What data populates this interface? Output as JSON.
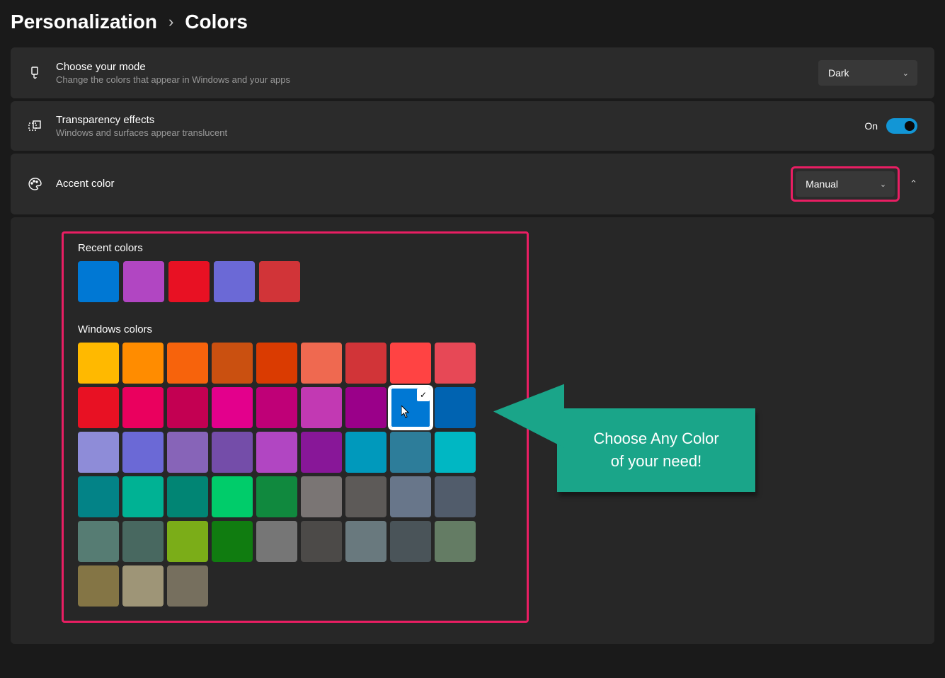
{
  "breadcrumb": {
    "parent": "Personalization",
    "current": "Colors"
  },
  "mode": {
    "title": "Choose your mode",
    "desc": "Change the colors that appear in Windows and your apps",
    "value": "Dark"
  },
  "transparency": {
    "title": "Transparency effects",
    "desc": "Windows and surfaces appear translucent",
    "state_label": "On"
  },
  "accent": {
    "title": "Accent color",
    "mode": "Manual"
  },
  "recent": {
    "label": "Recent colors",
    "colors": [
      "#0078d4",
      "#b146c2",
      "#e81123",
      "#6b69d6",
      "#d13438"
    ]
  },
  "windows": {
    "label": "Windows colors",
    "colors": [
      "#ffb900",
      "#ff8c00",
      "#f7630c",
      "#ca5010",
      "#da3b01",
      "#ef6950",
      "#d13438",
      "#ff4343",
      "#e74856",
      "#e81123",
      "#ea005e",
      "#c30052",
      "#e3008c",
      "#bf0077",
      "#c239b3",
      "#9a0089",
      "#0078d4",
      "#0063b1",
      "#8e8cd8",
      "#6b69d6",
      "#8764b8",
      "#744da9",
      "#b146c2",
      "#881798",
      "#0099bc",
      "#2d7d9a",
      "#00b7c3",
      "#038387",
      "#00b294",
      "#018574",
      "#00cc6a",
      "#10893e",
      "#7a7574",
      "#5d5a58",
      "#68768a",
      "#515c6b",
      "#567c73",
      "#486860",
      "#7bad18",
      "#107c10",
      "#767676",
      "#4c4a48",
      "#69797e",
      "#4a5459",
      "#647c64",
      "#847545",
      "#9e9577",
      "#766f5e"
    ],
    "selected_index": 16
  },
  "callout": {
    "line1": "Choose Any Color",
    "line2": "of your need!"
  }
}
